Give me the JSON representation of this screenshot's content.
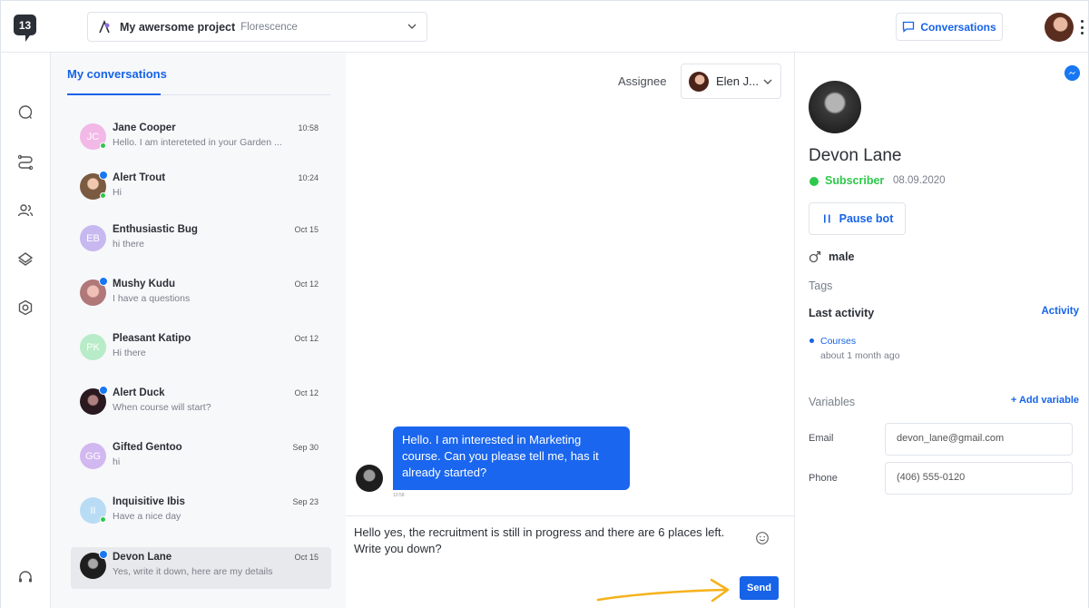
{
  "top": {
    "logo": "13",
    "project_name": "My awersome project",
    "project_sub": "Florescence",
    "conversations_btn": "Conversations"
  },
  "list": {
    "tab": "My conversations",
    "items": [
      {
        "initials": "JC",
        "name": "Jane Cooper",
        "time": "10:58",
        "preview": "Hello. I am intereteted in your Garden ...",
        "color": "#f2b8e6"
      },
      {
        "initials": "",
        "name": "Alert Trout",
        "time": "10:24",
        "preview": "Hi",
        "color": "#c9a27e"
      },
      {
        "initials": "EB",
        "name": "Enthusiastic Bug",
        "time": "Oct 15",
        "preview": "hi there",
        "color": "#c8b8f0"
      },
      {
        "initials": "",
        "name": "Mushy Kudu",
        "time": "Oct 12",
        "preview": "I have a questions",
        "color": "#d8a8a8"
      },
      {
        "initials": "PK",
        "name": "Pleasant Katipo",
        "time": "Oct 12",
        "preview": "Hi there",
        "color": "#b8ecc8"
      },
      {
        "initials": "",
        "name": "Alert Duck",
        "time": "Oct 12",
        "preview": "When course will start?",
        "color": "#5a3a40"
      },
      {
        "initials": "GG",
        "name": "Gifted Gentoo",
        "time": "Sep 30",
        "preview": "hi",
        "color": "#d2b8f0"
      },
      {
        "initials": "II",
        "name": "Inquisitive Ibis",
        "time": "Sep 23",
        "preview": "Have a nice day",
        "color": "#b8dcf4"
      },
      {
        "initials": "",
        "name": "Devon Lane",
        "time": "Oct 15",
        "preview": "Yes, write it down, here are my details",
        "color": "#222222"
      }
    ]
  },
  "chat": {
    "assignee_label": "Assignee",
    "assignee_name": "Elen J...",
    "message": "Hello.  I am interested in Marketing course.  Can you please tell me, has it already started?",
    "message_time": "10:58",
    "composer_text": "Hello  yes, the recruitment is still in progress and there are 6 places left.  Write you down?",
    "send": "Send"
  },
  "profile": {
    "name": "Devon Lane",
    "status": "Subscriber",
    "date": "08.09.2020",
    "pause_btn": "Pause bot",
    "gender": "male",
    "tags_label": "Tags",
    "last_activity_label": "Last activity",
    "activity_link": "Activity",
    "activity_item": "Courses",
    "activity_time": "about 1 month ago",
    "variables_label": "Variables",
    "add_variable": "+ Add variable",
    "email_label": "Email",
    "email_value": "devon_lane@gmail.com",
    "phone_label": "Phone",
    "phone_value": "(406) 555-0120"
  },
  "colors": {
    "accent": "#1663e8",
    "online": "#2ec84a",
    "messenger": "#1877f2"
  }
}
